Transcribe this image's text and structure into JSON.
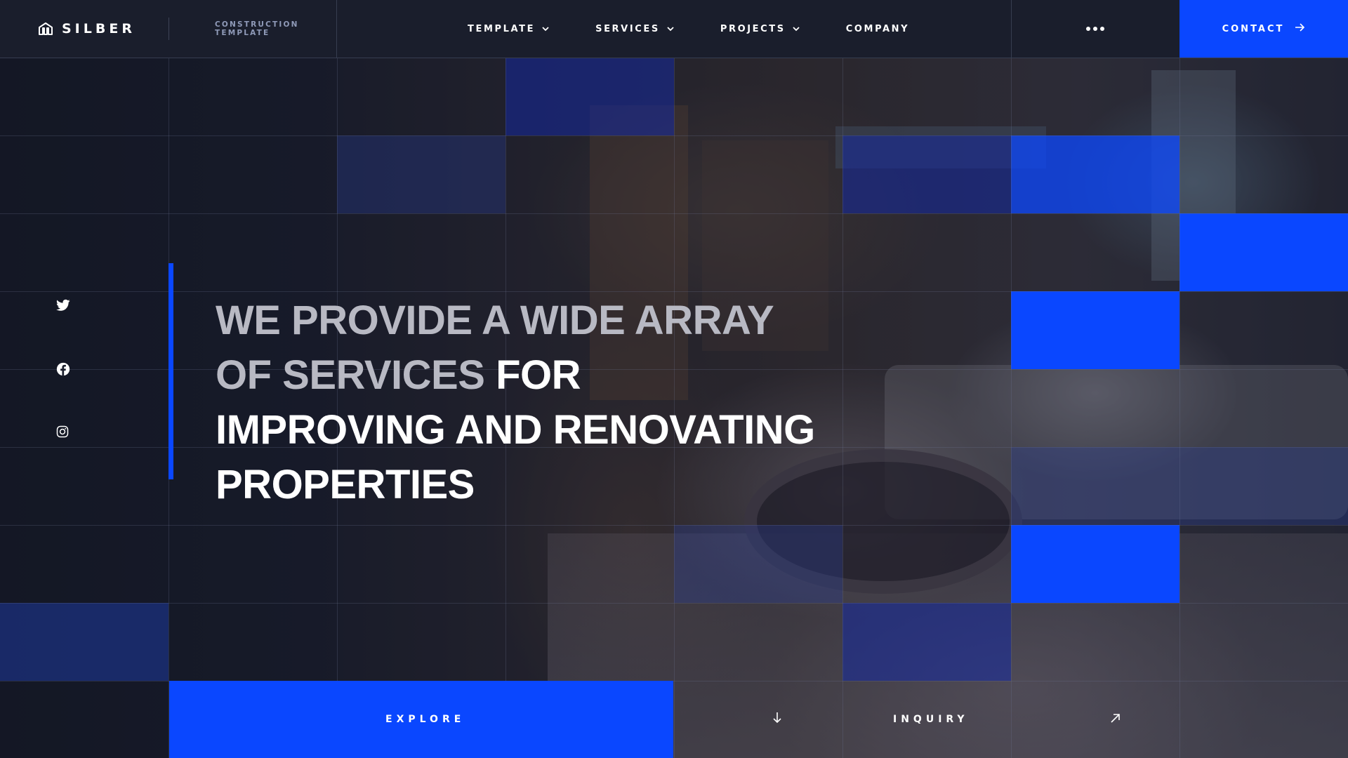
{
  "brand": {
    "name": "SILBER",
    "tagline": "CONSTRUCTION TEMPLATE"
  },
  "nav": {
    "items": [
      {
        "label": "TEMPLATE",
        "has_dropdown": true
      },
      {
        "label": "SERVICES",
        "has_dropdown": true
      },
      {
        "label": "PROJECTS",
        "has_dropdown": true
      },
      {
        "label": "COMPANY",
        "has_dropdown": false
      }
    ],
    "more_icon": "more-dots-icon",
    "contact_label": "CONTACT",
    "contact_icon": "arrow-right-icon"
  },
  "social": [
    "twitter-icon",
    "facebook-icon",
    "instagram-icon"
  ],
  "hero": {
    "headline_muted": "WE PROVIDE A WIDE ARRAY OF SERVICES",
    "headline_bright": "FOR IMPROVING AND RENOVATING PROPERTIES"
  },
  "actions": {
    "explore_label": "EXPLORE",
    "explore_icon": "arrow-down-icon",
    "inquiry_label": "INQUIRY",
    "inquiry_icon": "arrow-up-right-icon"
  },
  "colors": {
    "accent": "#0a47ff",
    "background": "#161a26",
    "header": "#1a1e2c",
    "muted_text": "#b8b9c3",
    "tagline": "#8f9ab8"
  }
}
